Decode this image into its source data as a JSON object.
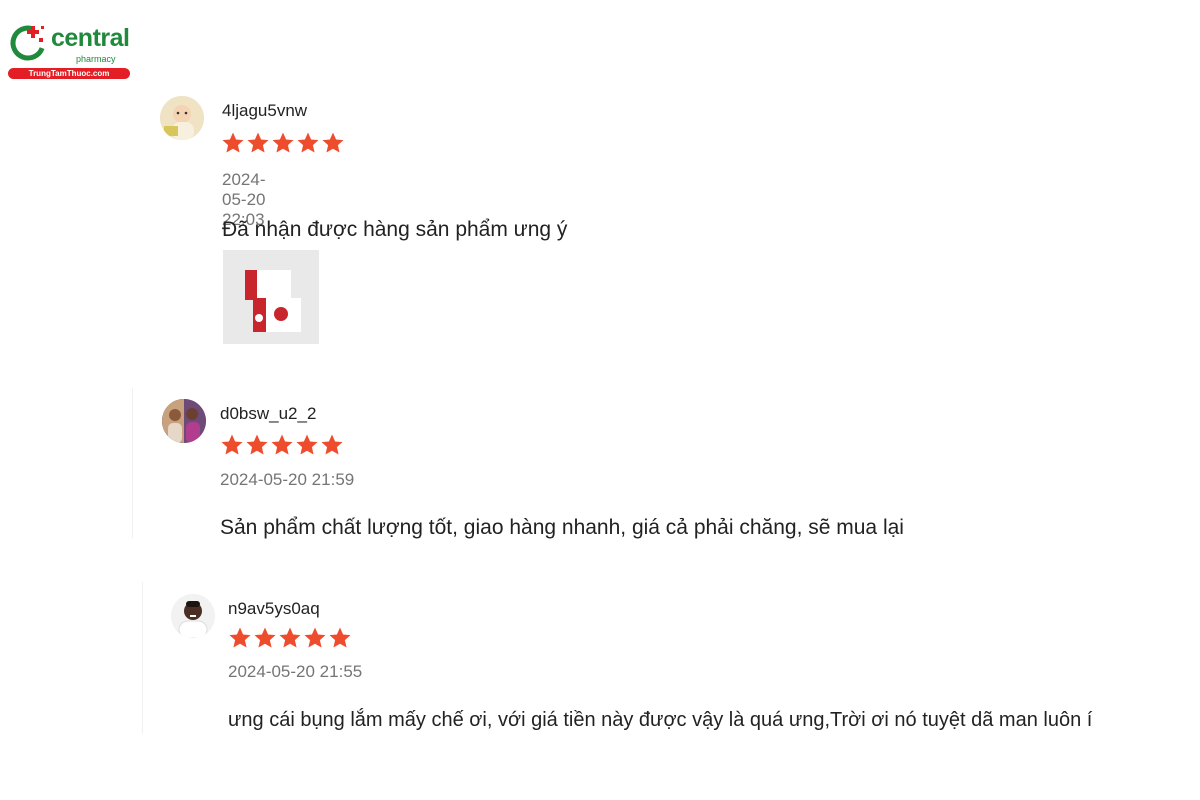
{
  "brand": {
    "name": "central",
    "sub": "pharmacy",
    "site": "TrungTamThuoc.com",
    "colors": {
      "green": "#1f8a3c",
      "red": "#e31e24"
    }
  },
  "reviews": [
    {
      "username": "4ljagu5vnw",
      "rating": 5,
      "date": "2024-05-20 22:03",
      "comment": "Đã nhận được hàng sản phẩm ưng ý",
      "has_photo": true
    },
    {
      "username": "d0bsw_u2_2",
      "rating": 5,
      "date": "2024-05-20 21:59",
      "comment": "Sản phẩm chất lượng tốt, giao hàng nhanh, giá cả phải chăng, sẽ mua lại"
    },
    {
      "username": "n9av5ys0aq",
      "rating": 5,
      "date": "2024-05-20 21:55",
      "comment": "ưng cái bụng lắm mấy chế ơi, với giá tiền này được vậy là quá ưng,Trời ơi nó tuyệt dã man luôn í"
    }
  ],
  "star_color": "#ee4d2d",
  "icons": {
    "star": "star-icon",
    "logo": "central-pharmacy-logo"
  }
}
